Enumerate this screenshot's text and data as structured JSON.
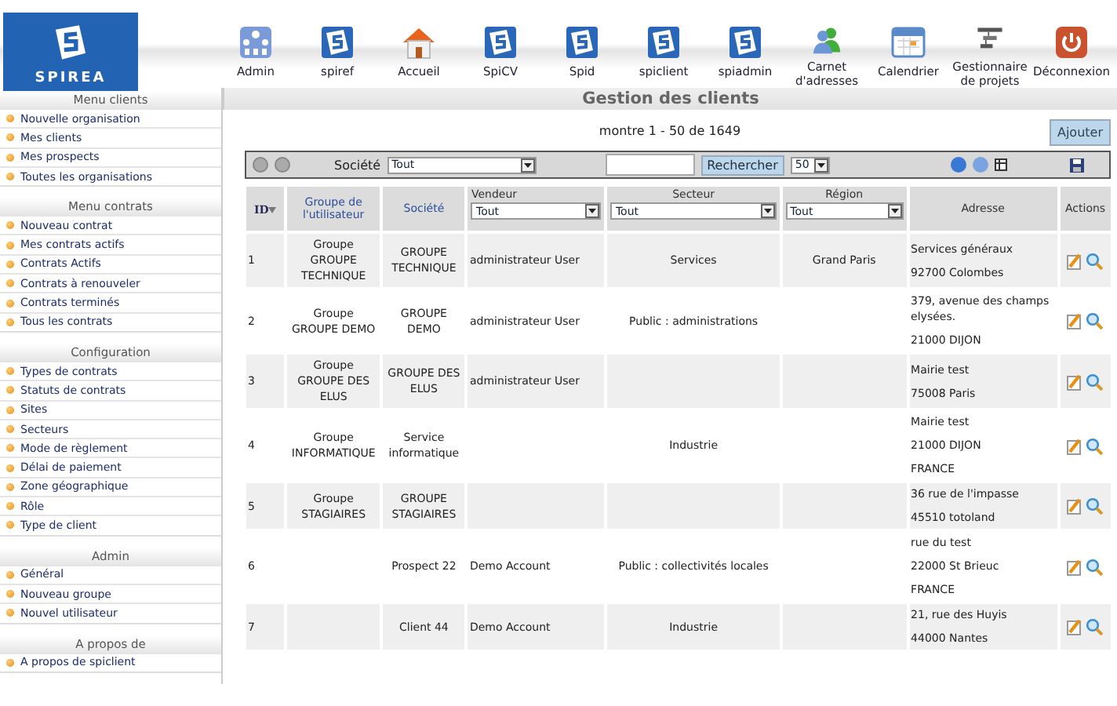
{
  "logo": {
    "text": "SPIREA"
  },
  "nav": [
    {
      "label": "Admin",
      "kind": "admin"
    },
    {
      "label": "spiref",
      "kind": "spi"
    },
    {
      "label": "Accueil",
      "kind": "home"
    },
    {
      "label": "SpiCV",
      "kind": "spi"
    },
    {
      "label": "Spid",
      "kind": "spi"
    },
    {
      "label": "spiclient",
      "kind": "spi"
    },
    {
      "label": "spiadmin",
      "kind": "spi"
    },
    {
      "label": "Carnet d'adresses",
      "kind": "contacts"
    },
    {
      "label": "Calendrier",
      "kind": "calendar"
    },
    {
      "label": "Gestionnaire de projets",
      "kind": "projects"
    },
    {
      "label": "Déconnexion",
      "kind": "logout"
    }
  ],
  "sidebar": [
    {
      "title": "Menu clients",
      "items": [
        "Nouvelle organisation",
        "Mes clients",
        "Mes prospects",
        "Toutes les organisations"
      ]
    },
    {
      "title": "Menu contrats",
      "items": [
        "Nouveau contrat",
        "Mes contrats actifs",
        "Contrats Actifs",
        "Contrats à renouveler",
        "Contrats terminés",
        "Tous les contrats"
      ]
    },
    {
      "title": "Configuration",
      "items": [
        "Types de contrats",
        "Statuts de contrats",
        "Sites",
        "Secteurs",
        "Mode de règlement",
        "Délai de paiement",
        "Zone géographique",
        "Rôle",
        "Type de client"
      ]
    },
    {
      "title": "Admin",
      "items": [
        "Général",
        "Nouveau groupe",
        "Nouvel utilisateur"
      ]
    },
    {
      "title": "A propos de",
      "items": [
        "A propos de spiclient"
      ]
    }
  ],
  "page_title": "Gestion des clients",
  "pagination": "montre 1 - 50 de 1649",
  "add_button": "Ajouter",
  "toolbar": {
    "company_label": "Société",
    "company_value": "Tout",
    "search_button": "Rechercher",
    "page_size": "50"
  },
  "columns": [
    {
      "label": "ID",
      "kind": "sort"
    },
    {
      "label": "Groupe de l'utilisateur",
      "kind": "link"
    },
    {
      "label": "Société",
      "kind": "link"
    },
    {
      "label": "Vendeur",
      "kind": "filter",
      "filter": "Tout"
    },
    {
      "label": "Secteur",
      "kind": "filter",
      "filter": "Tout"
    },
    {
      "label": "Région",
      "kind": "filter",
      "filter": "Tout"
    },
    {
      "label": "Adresse",
      "kind": "plain"
    },
    {
      "label": "Actions",
      "kind": "plain"
    }
  ],
  "rows": [
    {
      "id": "1",
      "group": "Groupe GROUPE TECHNIQUE",
      "company": "GROUPE TECHNIQUE",
      "seller": "administrateur User",
      "sector": "Services",
      "region": "Grand Paris",
      "address": [
        "Services généraux",
        "92700 Colombes"
      ]
    },
    {
      "id": "2",
      "group": "Groupe GROUPE DEMO",
      "company": "GROUPE DEMO",
      "seller": "administrateur User",
      "sector": "Public : administrations",
      "region": "",
      "address": [
        "379, avenue des champs elysées.",
        "21000 DIJON"
      ]
    },
    {
      "id": "3",
      "group": "Groupe GROUPE DES ELUS",
      "company": "GROUPE DES ELUS",
      "seller": "administrateur User",
      "sector": "",
      "region": "",
      "address": [
        "Mairie test",
        "75008 Paris"
      ]
    },
    {
      "id": "4",
      "group": "Groupe INFORMATIQUE",
      "company": "Service informatique",
      "seller": "",
      "sector": "Industrie",
      "region": "",
      "address": [
        "Mairie test",
        "21000 DIJON",
        "FRANCE"
      ]
    },
    {
      "id": "5",
      "group": "Groupe STAGIAIRES",
      "company": "GROUPE STAGIAIRES",
      "seller": "",
      "sector": "",
      "region": "",
      "address": [
        "36 rue de l'impasse",
        "45510 totoland"
      ]
    },
    {
      "id": "6",
      "group": "",
      "company": "Prospect 22",
      "seller": "Demo Account",
      "sector": "Public : collectivités locales",
      "region": "",
      "address": [
        "rue du test",
        "22000 St Brieuc",
        "FRANCE"
      ]
    },
    {
      "id": "7",
      "group": "",
      "company": "Client 44",
      "seller": "Demo Account",
      "sector": "Industrie",
      "region": "",
      "address": [
        "21, rue des Huyis",
        "44000 Nantes"
      ]
    }
  ]
}
